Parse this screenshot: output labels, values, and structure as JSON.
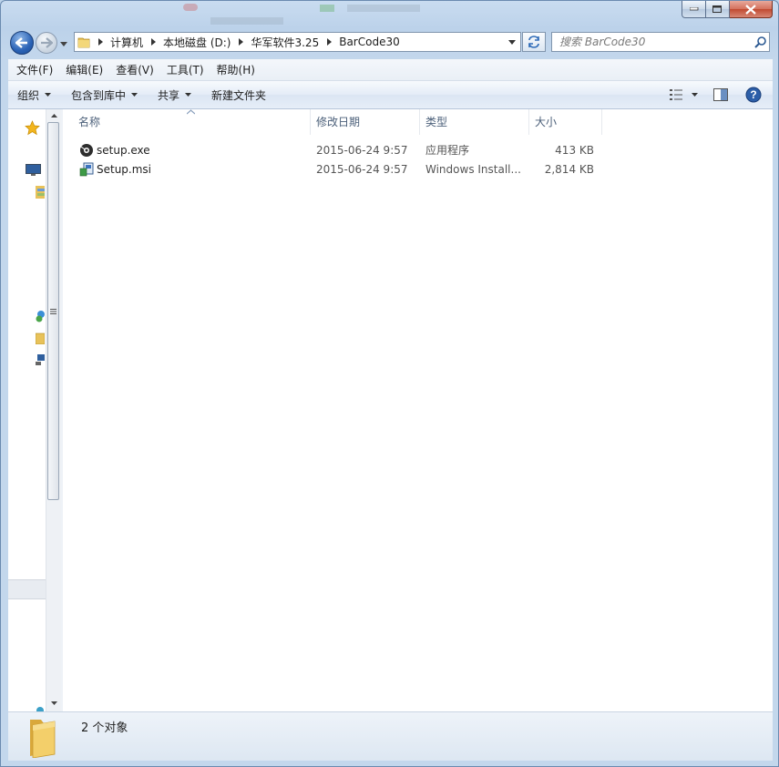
{
  "window": {
    "controls": {
      "minimize": "minimize",
      "maximize": "maximize",
      "close": "close"
    }
  },
  "address": {
    "crumbs": [
      "计算机",
      "本地磁盘 (D:)",
      "华军软件3.25",
      "BarCode30"
    ]
  },
  "search": {
    "placeholder": "搜索 BarCode30"
  },
  "menu": [
    "文件(F)",
    "编辑(E)",
    "查看(V)",
    "工具(T)",
    "帮助(H)"
  ],
  "toolbar": {
    "organize": "组织",
    "include_library": "包含到库中",
    "share": "共享",
    "new_folder": "新建文件夹"
  },
  "columns": {
    "name": "名称",
    "date": "修改日期",
    "type": "类型",
    "size": "大小"
  },
  "files": [
    {
      "name": "setup.exe",
      "date": "2015-06-24 9:57",
      "type": "应用程序",
      "size": "413 KB",
      "icon": "exe-icon"
    },
    {
      "name": "Setup.msi",
      "date": "2015-06-24 9:57",
      "type": "Windows Install...",
      "size": "2,814 KB",
      "icon": "msi-icon"
    }
  ],
  "status": {
    "count": "2 个对象"
  },
  "colors": {
    "accent": "#2a62b5",
    "header_text": "#4c607a"
  }
}
